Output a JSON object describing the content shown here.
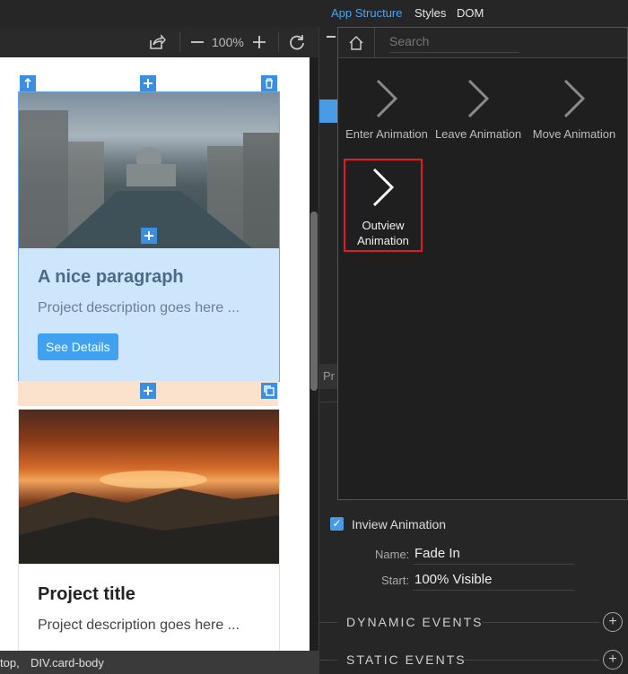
{
  "toolbar": {
    "zoom": "100%",
    "zoom_out_icon": "minus-icon",
    "zoom_in_icon": "plus-icon",
    "share_icon": "share-icon",
    "refresh_icon": "refresh-icon"
  },
  "canvas": {
    "card1": {
      "title": "A nice paragraph",
      "description": "Project description goes here ...",
      "button": "See Details"
    },
    "card2": {
      "title": "Project title",
      "description": "Project description goes here ..."
    }
  },
  "statusbar": {
    "left": "top,",
    "path": "DIV.card-body"
  },
  "right_tabs": [
    "App Structure",
    "Styles",
    "DOM"
  ],
  "popup": {
    "search_placeholder": "Search",
    "items": [
      {
        "label": "Enter Animation"
      },
      {
        "label": "Leave Animation"
      },
      {
        "label": "Move Animation"
      },
      {
        "label_line1": "Outview",
        "label_line2": "Animation"
      }
    ]
  },
  "behind_text": "Pr",
  "properties": {
    "inview_label": "Inview Animation",
    "inview_checked": true,
    "name_label": "Name:",
    "name_value": "Fade In",
    "start_label": "Start:",
    "start_value": "100% Visible",
    "dynamic_events": "DYNAMIC EVENTS",
    "static_events": "STATIC EVENTS"
  },
  "colors": {
    "accent": "#4a9be6",
    "selection_border": "#e01b24",
    "card_selected_bg": "#cde6fb"
  }
}
